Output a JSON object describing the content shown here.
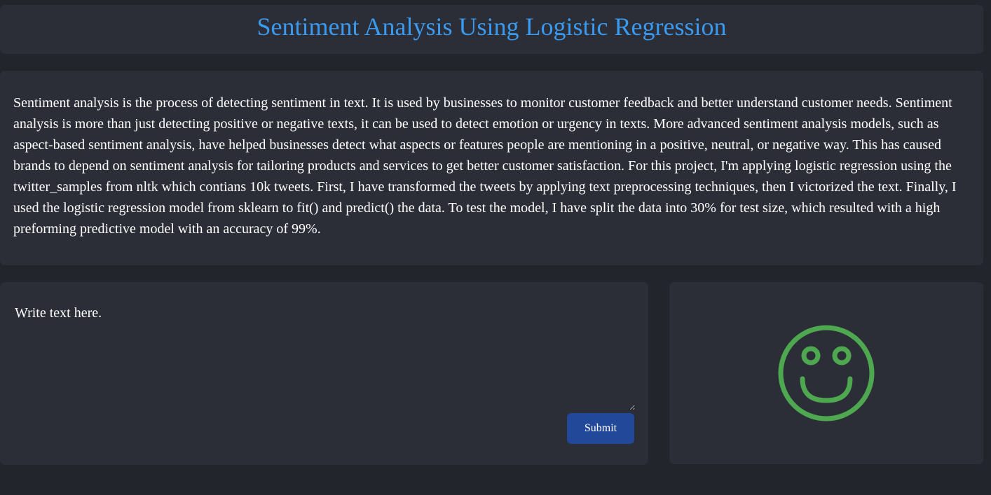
{
  "header": {
    "title": "Sentiment Analysis Using Logistic Regression"
  },
  "description": {
    "text": "Sentiment analysis is the process of detecting sentiment in text. It is used by businesses to monitor customer feedback and better understand customer needs. Sentiment analysis is more than just detecting positive or negative texts, it can be used to detect emotion or urgency in texts. More advanced sentiment analysis models, such as aspect-based sentiment analysis, have helped businesses detect what aspects or features people are mentioning in a positive, neutral, or negative way. This has caused brands to depend on sentiment analysis for tailoring products and services to get better customer satisfaction. For this project, I'm applying logistic regression using the twitter_samples from nltk which contians 10k tweets. First, I have transformed the tweets by applying text preprocessing techniques, then I victorized the text. Finally, I used the logistic regression model from sklearn to fit() and predict() the data. To test the model, I have split the data into 30% for test size, which resulted with a high preforming predictive model with an accuracy of 99%."
  },
  "input": {
    "placeholder": "Write text here.",
    "value": "",
    "submit_label": "Submit"
  },
  "result": {
    "icon": "smiley-face-icon",
    "sentiment": "positive",
    "color": "#4ea84f"
  },
  "colors": {
    "background": "#22252c",
    "panel": "#2b2e37",
    "title": "#3a9af0",
    "button": "#22489a"
  }
}
